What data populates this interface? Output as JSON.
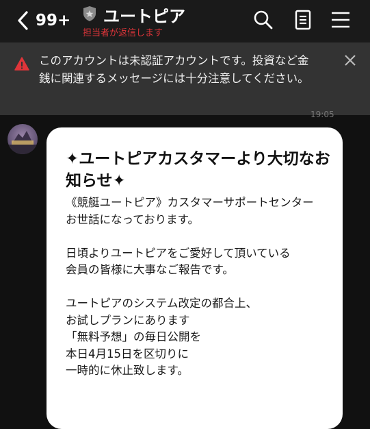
{
  "header": {
    "unread_count": "99+",
    "account_name": "ユートピア",
    "reply_status": "担当者が返信します"
  },
  "warning": {
    "text": "このアカウントは未認証アカウントです。投資など金銭に関連するメッセージには十分注意してください。"
  },
  "chat": {
    "timestamp": "19:05",
    "message": {
      "title": "✦ユートピアカスタマーより大切なお知らせ✦",
      "body": "《競艇ユートピア》カスタマーサポートセンター\nお世話になっております。\n\n日頃よりユートピアをご愛好して頂いている\n会員の皆様に大事なご報告です。\n\nユートピアのシステム改定の都合上、\nお試しプランにあります\n「無料予想」の毎日公開を\n本日4月15日を区切りに\n一時的に休止致します。"
    }
  },
  "colors": {
    "header_bg": "#1a1a1a",
    "warning_bg": "#333333",
    "alert_red": "#e0353a",
    "bubble_bg": "#ffffff"
  },
  "icons": [
    "chevron-left-icon",
    "shield-badge-icon",
    "search-icon",
    "notes-icon",
    "menu-icon",
    "warning-icon",
    "close-icon"
  ]
}
